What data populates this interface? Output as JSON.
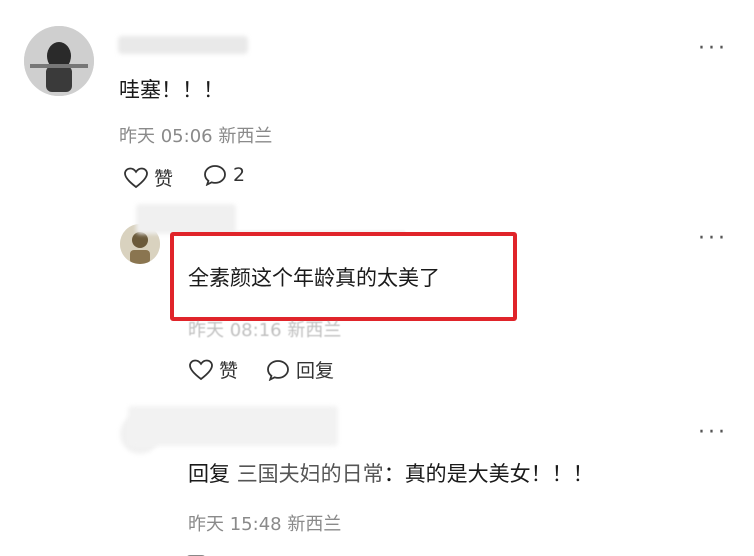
{
  "comments": [
    {
      "text": "哇塞！！！",
      "time": "昨天 05:06",
      "location": "新西兰",
      "like_label": "赞",
      "reply_count": "2",
      "more": "···"
    },
    {
      "text": "全素颜这个年龄真的太美了",
      "time": "昨天 08:16",
      "location": "新西兰",
      "like_label": "赞",
      "reply_label": "回复",
      "more": "···"
    },
    {
      "reply_prefix": "回复",
      "reply_to": "三国夫妇的日常",
      "text": "真的是大美女！！！",
      "time": "昨天 15:48",
      "location": "新西兰",
      "more": "···"
    }
  ],
  "colors": {
    "highlight": "#e0242a",
    "meta": "#8a8a8a"
  }
}
